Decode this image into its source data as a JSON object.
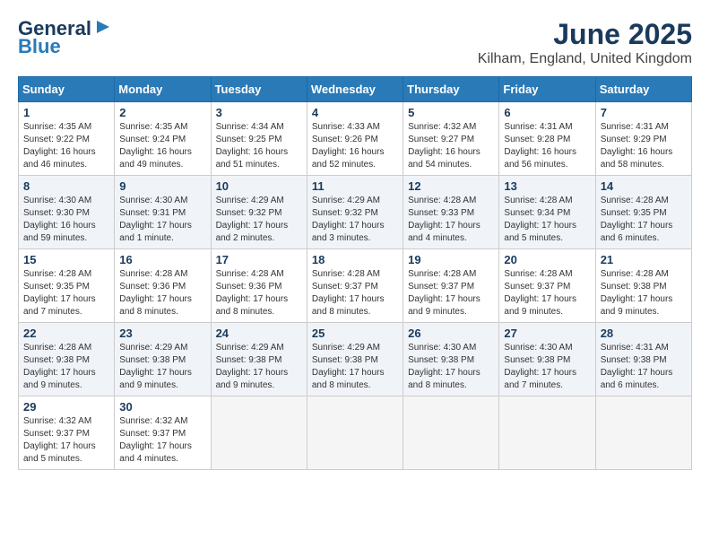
{
  "logo": {
    "line1": "General",
    "line2": "Blue"
  },
  "title": "June 2025",
  "location": "Kilham, England, United Kingdom",
  "days_of_week": [
    "Sunday",
    "Monday",
    "Tuesday",
    "Wednesday",
    "Thursday",
    "Friday",
    "Saturday"
  ],
  "weeks": [
    [
      {
        "day": "1",
        "info": "Sunrise: 4:35 AM\nSunset: 9:22 PM\nDaylight: 16 hours\nand 46 minutes."
      },
      {
        "day": "2",
        "info": "Sunrise: 4:35 AM\nSunset: 9:24 PM\nDaylight: 16 hours\nand 49 minutes."
      },
      {
        "day": "3",
        "info": "Sunrise: 4:34 AM\nSunset: 9:25 PM\nDaylight: 16 hours\nand 51 minutes."
      },
      {
        "day": "4",
        "info": "Sunrise: 4:33 AM\nSunset: 9:26 PM\nDaylight: 16 hours\nand 52 minutes."
      },
      {
        "day": "5",
        "info": "Sunrise: 4:32 AM\nSunset: 9:27 PM\nDaylight: 16 hours\nand 54 minutes."
      },
      {
        "day": "6",
        "info": "Sunrise: 4:31 AM\nSunset: 9:28 PM\nDaylight: 16 hours\nand 56 minutes."
      },
      {
        "day": "7",
        "info": "Sunrise: 4:31 AM\nSunset: 9:29 PM\nDaylight: 16 hours\nand 58 minutes."
      }
    ],
    [
      {
        "day": "8",
        "info": "Sunrise: 4:30 AM\nSunset: 9:30 PM\nDaylight: 16 hours\nand 59 minutes."
      },
      {
        "day": "9",
        "info": "Sunrise: 4:30 AM\nSunset: 9:31 PM\nDaylight: 17 hours\nand 1 minute."
      },
      {
        "day": "10",
        "info": "Sunrise: 4:29 AM\nSunset: 9:32 PM\nDaylight: 17 hours\nand 2 minutes."
      },
      {
        "day": "11",
        "info": "Sunrise: 4:29 AM\nSunset: 9:32 PM\nDaylight: 17 hours\nand 3 minutes."
      },
      {
        "day": "12",
        "info": "Sunrise: 4:28 AM\nSunset: 9:33 PM\nDaylight: 17 hours\nand 4 minutes."
      },
      {
        "day": "13",
        "info": "Sunrise: 4:28 AM\nSunset: 9:34 PM\nDaylight: 17 hours\nand 5 minutes."
      },
      {
        "day": "14",
        "info": "Sunrise: 4:28 AM\nSunset: 9:35 PM\nDaylight: 17 hours\nand 6 minutes."
      }
    ],
    [
      {
        "day": "15",
        "info": "Sunrise: 4:28 AM\nSunset: 9:35 PM\nDaylight: 17 hours\nand 7 minutes."
      },
      {
        "day": "16",
        "info": "Sunrise: 4:28 AM\nSunset: 9:36 PM\nDaylight: 17 hours\nand 8 minutes."
      },
      {
        "day": "17",
        "info": "Sunrise: 4:28 AM\nSunset: 9:36 PM\nDaylight: 17 hours\nand 8 minutes."
      },
      {
        "day": "18",
        "info": "Sunrise: 4:28 AM\nSunset: 9:37 PM\nDaylight: 17 hours\nand 8 minutes."
      },
      {
        "day": "19",
        "info": "Sunrise: 4:28 AM\nSunset: 9:37 PM\nDaylight: 17 hours\nand 9 minutes."
      },
      {
        "day": "20",
        "info": "Sunrise: 4:28 AM\nSunset: 9:37 PM\nDaylight: 17 hours\nand 9 minutes."
      },
      {
        "day": "21",
        "info": "Sunrise: 4:28 AM\nSunset: 9:38 PM\nDaylight: 17 hours\nand 9 minutes."
      }
    ],
    [
      {
        "day": "22",
        "info": "Sunrise: 4:28 AM\nSunset: 9:38 PM\nDaylight: 17 hours\nand 9 minutes."
      },
      {
        "day": "23",
        "info": "Sunrise: 4:29 AM\nSunset: 9:38 PM\nDaylight: 17 hours\nand 9 minutes."
      },
      {
        "day": "24",
        "info": "Sunrise: 4:29 AM\nSunset: 9:38 PM\nDaylight: 17 hours\nand 9 minutes."
      },
      {
        "day": "25",
        "info": "Sunrise: 4:29 AM\nSunset: 9:38 PM\nDaylight: 17 hours\nand 8 minutes."
      },
      {
        "day": "26",
        "info": "Sunrise: 4:30 AM\nSunset: 9:38 PM\nDaylight: 17 hours\nand 8 minutes."
      },
      {
        "day": "27",
        "info": "Sunrise: 4:30 AM\nSunset: 9:38 PM\nDaylight: 17 hours\nand 7 minutes."
      },
      {
        "day": "28",
        "info": "Sunrise: 4:31 AM\nSunset: 9:38 PM\nDaylight: 17 hours\nand 6 minutes."
      }
    ],
    [
      {
        "day": "29",
        "info": "Sunrise: 4:32 AM\nSunset: 9:37 PM\nDaylight: 17 hours\nand 5 minutes."
      },
      {
        "day": "30",
        "info": "Sunrise: 4:32 AM\nSunset: 9:37 PM\nDaylight: 17 hours\nand 4 minutes."
      },
      {
        "day": "",
        "info": ""
      },
      {
        "day": "",
        "info": ""
      },
      {
        "day": "",
        "info": ""
      },
      {
        "day": "",
        "info": ""
      },
      {
        "day": "",
        "info": ""
      }
    ]
  ]
}
